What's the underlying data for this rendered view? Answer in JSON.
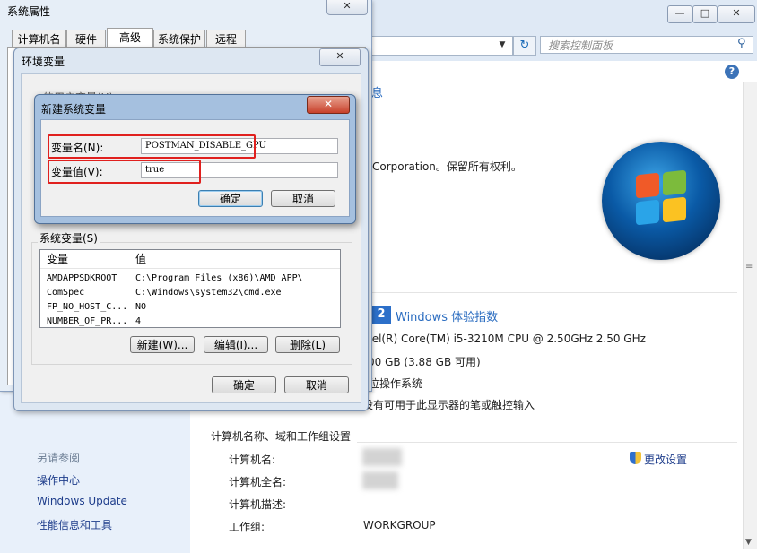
{
  "control_panel": {
    "search_placeholder": "搜索控制面板",
    "info_link": "息",
    "copyright": "Corporation。保留所有权利。",
    "wei": {
      "badge": "2",
      "link": "Windows 体验指数"
    },
    "specs": [
      "tel(R) Core(TM) i5-3210M CPU @ 2.50GHz   2.50 GHz",
      "00 GB (3.88 GB 可用)",
      "位操作系统",
      "没有可用于此显示器的笔或触控输入"
    ],
    "section_title": "计算机名称、域和工作组设置",
    "computer_rows": [
      {
        "label": "计算机名:",
        "value": ""
      },
      {
        "label": "计算机全名:",
        "value": ""
      },
      {
        "label": "计算机描述:",
        "value": ""
      },
      {
        "label": "工作组:",
        "value": "WORKGROUP"
      }
    ],
    "change_settings": "更改设置",
    "sidebar": {
      "see_also": "另请参阅",
      "links": [
        "操作中心",
        "Windows Update",
        "性能信息和工具"
      ]
    }
  },
  "system_properties": {
    "title": "系统属性",
    "tabs": [
      "计算机名",
      "硬件",
      "高级",
      "系统保护",
      "远程"
    ]
  },
  "env_vars": {
    "title": "环境变量",
    "user_vars_label": "的用户变量(U)",
    "system_vars_label": "系统变量(S)",
    "columns": [
      "变量",
      "值"
    ],
    "rows": [
      {
        "name": "AMDAPPSDKROOT",
        "value": "C:\\Program Files (x86)\\AMD APP\\"
      },
      {
        "name": "ComSpec",
        "value": "C:\\Windows\\system32\\cmd.exe"
      },
      {
        "name": "FP_NO_HOST_C...",
        "value": "NO"
      },
      {
        "name": "NUMBER_OF_PR...",
        "value": "4"
      }
    ],
    "buttons": {
      "new": "新建(W)...",
      "edit": "编辑(I)...",
      "delete": "删除(L)"
    },
    "ok": "确定",
    "cancel": "取消"
  },
  "new_var": {
    "title": "新建系统变量",
    "name_label": "变量名(N):",
    "value_label": "变量值(V):",
    "name_value": "POSTMAN_DISABLE_GPU",
    "value_value": "true",
    "ok": "确定",
    "cancel": "取消"
  }
}
